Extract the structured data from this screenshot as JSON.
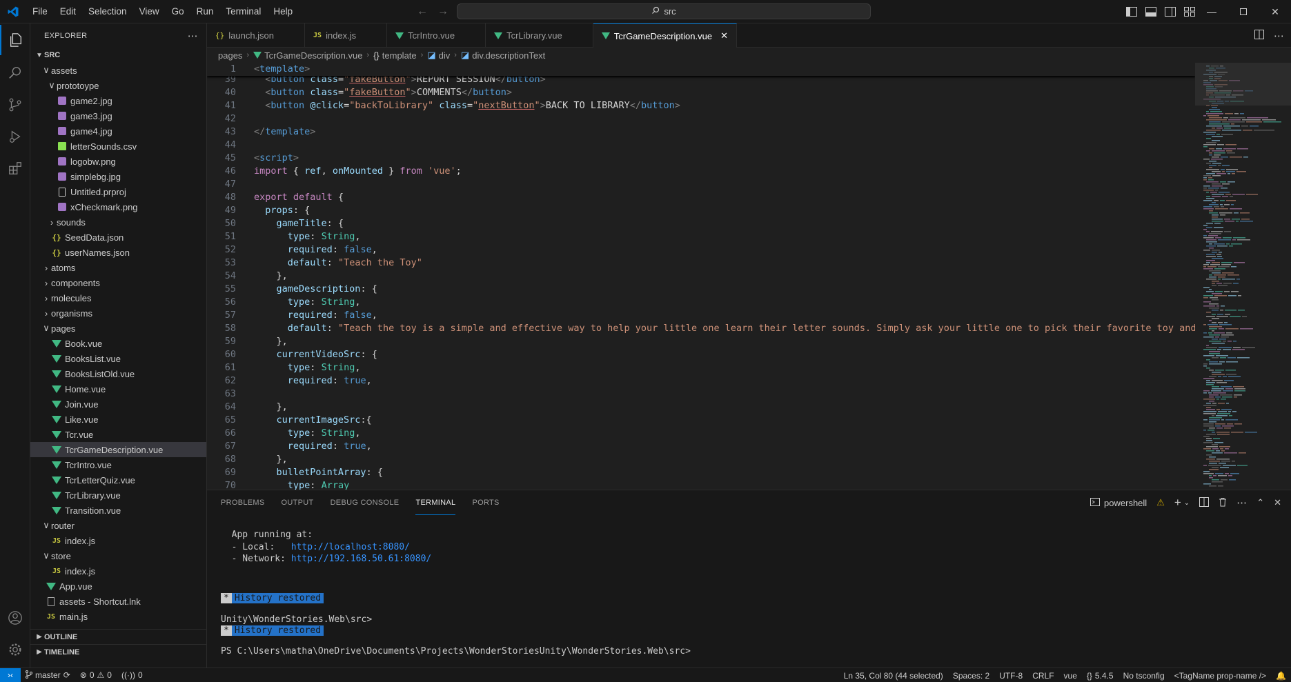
{
  "menubar": [
    "File",
    "Edit",
    "Selection",
    "View",
    "Go",
    "Run",
    "Terminal",
    "Help"
  ],
  "command_center": {
    "text": "src"
  },
  "sidebar": {
    "header": "EXPLORER",
    "root": "SRC",
    "tree": [
      {
        "label": "assets",
        "type": "folder",
        "open": true,
        "depth": 1
      },
      {
        "label": "prototoype",
        "type": "folder",
        "open": true,
        "depth": 2
      },
      {
        "label": "game2.jpg",
        "type": "img",
        "depth": 2
      },
      {
        "label": "game3.jpg",
        "type": "img",
        "depth": 2
      },
      {
        "label": "game4.jpg",
        "type": "img",
        "depth": 2
      },
      {
        "label": "letterSounds.csv",
        "type": "csv",
        "depth": 2
      },
      {
        "label": "logobw.png",
        "type": "img",
        "depth": 2
      },
      {
        "label": "simplebg.jpg",
        "type": "img",
        "depth": 2
      },
      {
        "label": "Untitled.prproj",
        "type": "file",
        "depth": 2
      },
      {
        "label": "xCheckmark.png",
        "type": "img",
        "depth": 2
      },
      {
        "label": "sounds",
        "type": "folder",
        "open": false,
        "depth": 2
      },
      {
        "label": "SeedData.json",
        "type": "json",
        "depth": 1
      },
      {
        "label": "userNames.json",
        "type": "json",
        "depth": 1
      },
      {
        "label": "atoms",
        "type": "folder",
        "open": false,
        "depth": 1
      },
      {
        "label": "components",
        "type": "folder",
        "open": false,
        "depth": 1
      },
      {
        "label": "molecules",
        "type": "folder",
        "open": false,
        "depth": 1
      },
      {
        "label": "organisms",
        "type": "folder",
        "open": false,
        "depth": 1
      },
      {
        "label": "pages",
        "type": "folder",
        "open": true,
        "depth": 1
      },
      {
        "label": "Book.vue",
        "type": "vue",
        "depth": 1
      },
      {
        "label": "BooksList.vue",
        "type": "vue",
        "depth": 1
      },
      {
        "label": "BooksListOld.vue",
        "type": "vue",
        "depth": 1
      },
      {
        "label": "Home.vue",
        "type": "vue",
        "depth": 1
      },
      {
        "label": "Join.vue",
        "type": "vue",
        "depth": 1
      },
      {
        "label": "Like.vue",
        "type": "vue",
        "depth": 1
      },
      {
        "label": "Tcr.vue",
        "type": "vue",
        "depth": 1
      },
      {
        "label": "TcrGameDescription.vue",
        "type": "vue",
        "depth": 1,
        "selected": true
      },
      {
        "label": "TcrIntro.vue",
        "type": "vue",
        "depth": 1
      },
      {
        "label": "TcrLetterQuiz.vue",
        "type": "vue",
        "depth": 1
      },
      {
        "label": "TcrLibrary.vue",
        "type": "vue",
        "depth": 1
      },
      {
        "label": "Transition.vue",
        "type": "vue",
        "depth": 1
      },
      {
        "label": "router",
        "type": "folder",
        "open": true,
        "depth": 1
      },
      {
        "label": "index.js",
        "type": "js",
        "depth": 1
      },
      {
        "label": "store",
        "type": "folder",
        "open": true,
        "depth": 1
      },
      {
        "label": "index.js",
        "type": "js",
        "depth": 1
      },
      {
        "label": "App.vue",
        "type": "vue",
        "depth": 0
      },
      {
        "label": "assets - Shortcut.lnk",
        "type": "lnk",
        "depth": 0
      },
      {
        "label": "main.js",
        "type": "js",
        "depth": 0
      }
    ],
    "outline": "OUTLINE",
    "timeline": "TIMELINE"
  },
  "tabs": [
    {
      "label": "launch.json",
      "icon": "json"
    },
    {
      "label": "index.js",
      "icon": "js"
    },
    {
      "label": "TcrIntro.vue",
      "icon": "vue"
    },
    {
      "label": "TcrLibrary.vue",
      "icon": "vue"
    },
    {
      "label": "TcrGameDescription.vue",
      "icon": "vue",
      "active": true
    }
  ],
  "breadcrumb": [
    "pages",
    "TcrGameDescription.vue",
    "template",
    "div",
    "div.descriptionText"
  ],
  "editor": {
    "lines": [
      {
        "n": "1",
        "sticky": true,
        "tokens": [
          [
            "tk-punc",
            "<"
          ],
          [
            "tk-tag",
            "template"
          ],
          [
            "tk-punc",
            ">"
          ]
        ]
      },
      {
        "n": "39",
        "tokens": [
          [
            "tk-text",
            "  "
          ],
          [
            "tk-punc",
            "<"
          ],
          [
            "tk-tag",
            "button"
          ],
          [
            "tk-text",
            " "
          ],
          [
            "tk-attr",
            "class"
          ],
          [
            "tk-text",
            "="
          ],
          [
            "tk-str",
            "\""
          ],
          [
            "tk-str tk-under",
            "fakeButton"
          ],
          [
            "tk-str",
            "\""
          ],
          [
            "tk-punc",
            ">"
          ],
          [
            "tk-text",
            "REPORT SESSION"
          ],
          [
            "tk-punc",
            "</"
          ],
          [
            "tk-tag",
            "button"
          ],
          [
            "tk-punc",
            ">"
          ]
        ]
      },
      {
        "n": "40",
        "tokens": [
          [
            "tk-text",
            "  "
          ],
          [
            "tk-punc",
            "<"
          ],
          [
            "tk-tag",
            "button"
          ],
          [
            "tk-text",
            " "
          ],
          [
            "tk-attr",
            "class"
          ],
          [
            "tk-text",
            "="
          ],
          [
            "tk-str",
            "\""
          ],
          [
            "tk-str tk-under",
            "fakeButton"
          ],
          [
            "tk-str",
            "\""
          ],
          [
            "tk-punc",
            ">"
          ],
          [
            "tk-text",
            "COMMENTS"
          ],
          [
            "tk-punc",
            "</"
          ],
          [
            "tk-tag",
            "button"
          ],
          [
            "tk-punc",
            ">"
          ]
        ]
      },
      {
        "n": "41",
        "tokens": [
          [
            "tk-text",
            "  "
          ],
          [
            "tk-punc",
            "<"
          ],
          [
            "tk-tag",
            "button"
          ],
          [
            "tk-text",
            " "
          ],
          [
            "tk-attr",
            "@click"
          ],
          [
            "tk-text",
            "="
          ],
          [
            "tk-str",
            "\"backToLibrary\""
          ],
          [
            "tk-text",
            " "
          ],
          [
            "tk-attr",
            "class"
          ],
          [
            "tk-text",
            "="
          ],
          [
            "tk-str",
            "\""
          ],
          [
            "tk-str tk-under",
            "nextButton"
          ],
          [
            "tk-str",
            "\""
          ],
          [
            "tk-punc",
            ">"
          ],
          [
            "tk-text",
            "BACK TO LIBRARY"
          ],
          [
            "tk-punc",
            "</"
          ],
          [
            "tk-tag",
            "button"
          ],
          [
            "tk-punc",
            ">"
          ]
        ]
      },
      {
        "n": "42",
        "tokens": []
      },
      {
        "n": "43",
        "tokens": [
          [
            "tk-punc",
            "</"
          ],
          [
            "tk-tag",
            "template"
          ],
          [
            "tk-punc",
            ">"
          ]
        ]
      },
      {
        "n": "44",
        "tokens": []
      },
      {
        "n": "45",
        "tokens": [
          [
            "tk-punc",
            "<"
          ],
          [
            "tk-tag",
            "script"
          ],
          [
            "tk-punc",
            ">"
          ]
        ]
      },
      {
        "n": "46",
        "tokens": [
          [
            "tk-kw",
            "import"
          ],
          [
            "tk-text",
            " { "
          ],
          [
            "tk-key",
            "ref"
          ],
          [
            "tk-text",
            ", "
          ],
          [
            "tk-key",
            "onMounted"
          ],
          [
            "tk-text",
            " } "
          ],
          [
            "tk-kw",
            "from"
          ],
          [
            "tk-text",
            " "
          ],
          [
            "tk-str",
            "'vue'"
          ],
          [
            "tk-text",
            ";"
          ]
        ]
      },
      {
        "n": "47",
        "tokens": []
      },
      {
        "n": "48",
        "tokens": [
          [
            "tk-kw",
            "export default"
          ],
          [
            "tk-text",
            " {"
          ]
        ]
      },
      {
        "n": "49",
        "tokens": [
          [
            "tk-text",
            "  "
          ],
          [
            "tk-key",
            "props"
          ],
          [
            "tk-text",
            ": {"
          ]
        ]
      },
      {
        "n": "50",
        "tokens": [
          [
            "tk-text",
            "    "
          ],
          [
            "tk-key",
            "gameTitle"
          ],
          [
            "tk-text",
            ": {"
          ]
        ]
      },
      {
        "n": "51",
        "tokens": [
          [
            "tk-text",
            "      "
          ],
          [
            "tk-key",
            "type"
          ],
          [
            "tk-text",
            ": "
          ],
          [
            "tk-type",
            "String"
          ],
          [
            "tk-text",
            ","
          ]
        ]
      },
      {
        "n": "52",
        "tokens": [
          [
            "tk-text",
            "      "
          ],
          [
            "tk-key",
            "required"
          ],
          [
            "tk-text",
            ": "
          ],
          [
            "tk-bool",
            "false"
          ],
          [
            "tk-text",
            ","
          ]
        ]
      },
      {
        "n": "53",
        "tokens": [
          [
            "tk-text",
            "      "
          ],
          [
            "tk-key",
            "default"
          ],
          [
            "tk-text",
            ": "
          ],
          [
            "tk-str",
            "\"Teach the Toy\""
          ]
        ]
      },
      {
        "n": "54",
        "tokens": [
          [
            "tk-text",
            "    },"
          ]
        ]
      },
      {
        "n": "55",
        "tokens": [
          [
            "tk-text",
            "    "
          ],
          [
            "tk-key",
            "gameDescription"
          ],
          [
            "tk-text",
            ": {"
          ]
        ]
      },
      {
        "n": "56",
        "tokens": [
          [
            "tk-text",
            "      "
          ],
          [
            "tk-key",
            "type"
          ],
          [
            "tk-text",
            ": "
          ],
          [
            "tk-type",
            "String"
          ],
          [
            "tk-text",
            ","
          ]
        ]
      },
      {
        "n": "57",
        "tokens": [
          [
            "tk-text",
            "      "
          ],
          [
            "tk-key",
            "required"
          ],
          [
            "tk-text",
            ": "
          ],
          [
            "tk-bool",
            "false"
          ],
          [
            "tk-text",
            ","
          ]
        ]
      },
      {
        "n": "58",
        "tokens": [
          [
            "tk-text",
            "      "
          ],
          [
            "tk-key",
            "default"
          ],
          [
            "tk-text",
            ": "
          ],
          [
            "tk-str",
            "\"Teach the toy is a simple and effective way to help your little one learn their letter sounds. Simply ask your little one to pick their favorite toy and then inst"
          ]
        ]
      },
      {
        "n": "59",
        "tokens": [
          [
            "tk-text",
            "    },"
          ]
        ]
      },
      {
        "n": "60",
        "tokens": [
          [
            "tk-text",
            "    "
          ],
          [
            "tk-key",
            "currentVideoSrc"
          ],
          [
            "tk-text",
            ": {"
          ]
        ]
      },
      {
        "n": "61",
        "tokens": [
          [
            "tk-text",
            "      "
          ],
          [
            "tk-key",
            "type"
          ],
          [
            "tk-text",
            ": "
          ],
          [
            "tk-type",
            "String"
          ],
          [
            "tk-text",
            ","
          ]
        ]
      },
      {
        "n": "62",
        "tokens": [
          [
            "tk-text",
            "      "
          ],
          [
            "tk-key",
            "required"
          ],
          [
            "tk-text",
            ": "
          ],
          [
            "tk-bool",
            "true"
          ],
          [
            "tk-text",
            ","
          ]
        ]
      },
      {
        "n": "63",
        "tokens": []
      },
      {
        "n": "64",
        "tokens": [
          [
            "tk-text",
            "    },"
          ]
        ]
      },
      {
        "n": "65",
        "tokens": [
          [
            "tk-text",
            "    "
          ],
          [
            "tk-key",
            "currentImageSrc"
          ],
          [
            "tk-text",
            ":{"
          ]
        ]
      },
      {
        "n": "66",
        "tokens": [
          [
            "tk-text",
            "      "
          ],
          [
            "tk-key",
            "type"
          ],
          [
            "tk-text",
            ": "
          ],
          [
            "tk-type",
            "String"
          ],
          [
            "tk-text",
            ","
          ]
        ]
      },
      {
        "n": "67",
        "tokens": [
          [
            "tk-text",
            "      "
          ],
          [
            "tk-key",
            "required"
          ],
          [
            "tk-text",
            ": "
          ],
          [
            "tk-bool",
            "true"
          ],
          [
            "tk-text",
            ","
          ]
        ]
      },
      {
        "n": "68",
        "tokens": [
          [
            "tk-text",
            "    },"
          ]
        ]
      },
      {
        "n": "69",
        "tokens": [
          [
            "tk-text",
            "    "
          ],
          [
            "tk-key",
            "bulletPointArray"
          ],
          [
            "tk-text",
            ": {"
          ]
        ]
      },
      {
        "n": "70",
        "tokens": [
          [
            "tk-text",
            "      "
          ],
          [
            "tk-key",
            "type"
          ],
          [
            "tk-text",
            ": "
          ],
          [
            "tk-type",
            "Array"
          ]
        ]
      }
    ]
  },
  "panel": {
    "tabs": [
      "PROBLEMS",
      "OUTPUT",
      "DEBUG CONSOLE",
      "TERMINAL",
      "PORTS"
    ],
    "active_tab": "TERMINAL",
    "shell": "powershell",
    "terminal": {
      "app_running": "  App running at:",
      "local_label": "  - Local:   ",
      "local_url": "http://localhost:8080/",
      "network_label": "  - Network: ",
      "network_url": "http://192.168.50.61:8080/",
      "restored_star": "*",
      "restored_text": "History restored",
      "path_line": "Unity\\WonderStories.Web\\src>",
      "prompt": "PS C:\\Users\\matha\\OneDrive\\Documents\\Projects\\WonderStoriesUnity\\WonderStories.Web\\src>"
    }
  },
  "statusbar": {
    "branch": "master",
    "errors": "0",
    "warnings": "0",
    "ports": "0",
    "position": "Ln 35, Col 80 (44 selected)",
    "spaces": "Spaces: 2",
    "encoding": "UTF-8",
    "eol": "CRLF",
    "language": "vue",
    "version": "5.4.5",
    "tsconfig": "No tsconfig",
    "tagname": "<TagName prop-name />"
  },
  "colors": {
    "accent": "#0078d4",
    "vue": "#41b883",
    "background": "#1f1f1f",
    "chrome": "#181818"
  }
}
